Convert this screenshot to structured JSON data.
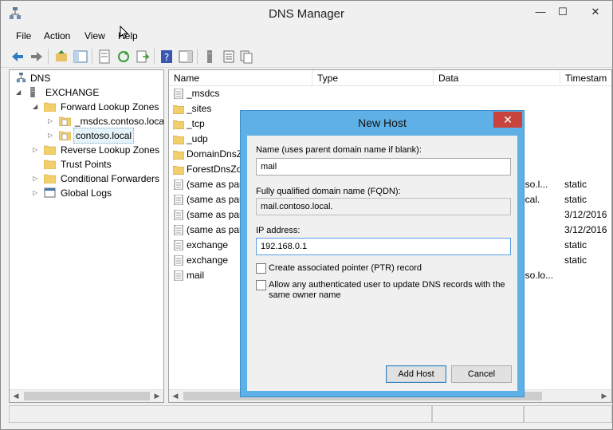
{
  "window": {
    "title": "DNS Manager",
    "controls": {
      "minimize": "—",
      "maximize": "☐",
      "close": "✕"
    }
  },
  "menu": [
    "File",
    "Action",
    "View",
    "Help"
  ],
  "tree": {
    "root": "DNS",
    "server": "EXCHANGE",
    "forward_zones": "Forward Lookup Zones",
    "zone_msdcs": "_msdcs.contoso.local",
    "zone_contoso": "contoso.local",
    "reverse_zones": "Reverse Lookup Zones",
    "trust_points": "Trust Points",
    "conditional_forwarders": "Conditional Forwarders",
    "global_logs": "Global Logs"
  },
  "list": {
    "columns": [
      "Name",
      "Type",
      "Data",
      "Timestam"
    ],
    "rows": [
      {
        "icon": "record-icon",
        "name": "_msdcs",
        "data": "",
        "ts": ""
      },
      {
        "icon": "folder-icon",
        "name": "_sites",
        "data": "",
        "ts": ""
      },
      {
        "icon": "folder-icon",
        "name": "_tcp",
        "data": "",
        "ts": ""
      },
      {
        "icon": "folder-icon",
        "name": "_udp",
        "data": "",
        "ts": ""
      },
      {
        "icon": "folder-icon",
        "name": "DomainDnsZo",
        "data": "",
        "ts": ""
      },
      {
        "icon": "folder-icon",
        "name": "ForestDnsZor",
        "data": "",
        "ts": ""
      },
      {
        "icon": "record-icon",
        "name": "(same as pare",
        "data": "oso.l...",
        "ts": "static"
      },
      {
        "icon": "record-icon",
        "name": "(same as pare",
        "data": "ocal.",
        "ts": "static"
      },
      {
        "icon": "record-icon",
        "name": "(same as pare",
        "data": "",
        "ts": "3/12/2016"
      },
      {
        "icon": "record-icon",
        "name": "(same as pare",
        "data": "",
        "ts": "3/12/2016"
      },
      {
        "icon": "record-icon",
        "name": "exchange",
        "data": "",
        "ts": "static"
      },
      {
        "icon": "record-icon",
        "name": "exchange",
        "data": "",
        "ts": "static"
      },
      {
        "icon": "record-icon",
        "name": "mail",
        "data": "oso.lo...",
        "ts": ""
      }
    ]
  },
  "dialog": {
    "title": "New Host",
    "close": "✕",
    "name_label": "Name (uses parent domain name if blank):",
    "name_value": "mail",
    "fqdn_label": "Fully qualified domain name (FQDN):",
    "fqdn_value": "mail.contoso.local.",
    "ip_label": "IP address:",
    "ip_value": "192.168.0.1",
    "ptr_label": "Create associated pointer (PTR) record",
    "auth_label_1": "Allow any authenticated user to update DNS records with the",
    "auth_label_2": "same owner name",
    "add_button": "Add Host",
    "cancel_button": "Cancel"
  },
  "colors": {
    "dialog_frame": "#5fb0e6",
    "close_red": "#c7433b",
    "selection": "#e5f3fb"
  }
}
